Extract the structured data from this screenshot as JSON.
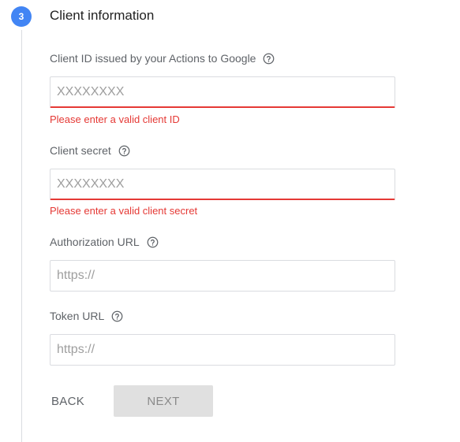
{
  "step": {
    "number": "3",
    "title": "Client information"
  },
  "fields": [
    {
      "label": "Client ID issued by your Actions to Google",
      "placeholder": "XXXXXXXX",
      "value": "",
      "error": "Please enter a valid client ID"
    },
    {
      "label": "Client secret",
      "placeholder": "XXXXXXXX",
      "value": "",
      "error": "Please enter a valid client secret"
    },
    {
      "label": "Authorization URL",
      "placeholder": "https://",
      "value": ""
    },
    {
      "label": "Token URL",
      "placeholder": "https://",
      "value": ""
    }
  ],
  "buttons": {
    "back": "BACK",
    "next": "NEXT",
    "next_disabled": true
  },
  "icons": {
    "help": "help-circle-outline-icon"
  },
  "colors": {
    "step_accent": "#4285f4",
    "error": "#e53935",
    "disabled_button": "#e0e0e0"
  }
}
